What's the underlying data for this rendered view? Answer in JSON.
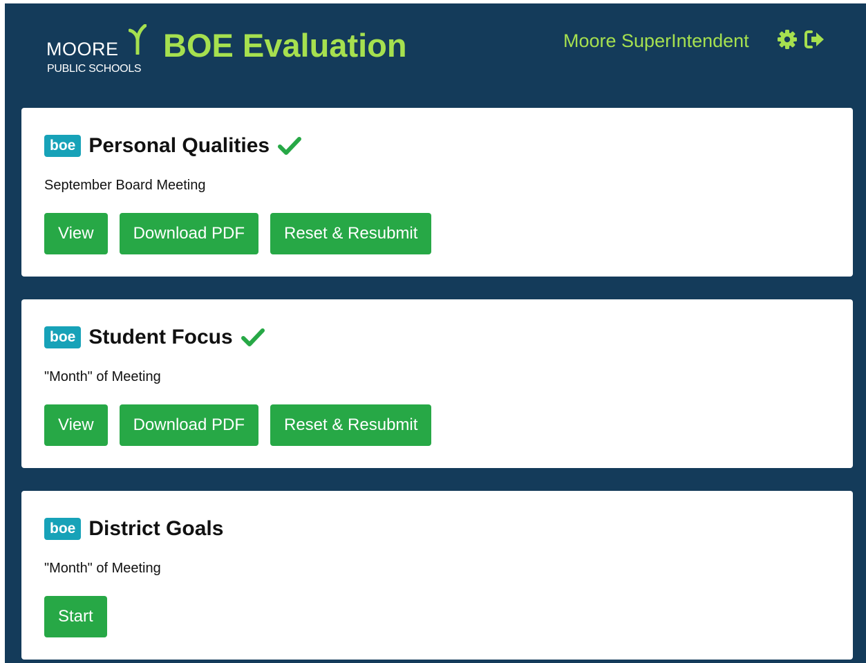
{
  "header": {
    "logo_name": "MOORE",
    "logo_subtitle": "PUBLIC SCHOOLS",
    "app_title": "BOE Evaluation",
    "user_name": "Moore SuperIntendent",
    "icons": [
      "gear-icon",
      "sign-out-icon"
    ]
  },
  "colors": {
    "background": "#143b5a",
    "accent": "#a6e04f",
    "badge": "#17a2b8",
    "button": "#27a846",
    "check": "#27a846"
  },
  "evaluations": [
    {
      "badge": "boe",
      "title": "Personal Qualities",
      "completed": true,
      "subtitle": "September Board Meeting",
      "buttons": [
        "View",
        "Download PDF",
        "Reset & Resubmit"
      ]
    },
    {
      "badge": "boe",
      "title": "Student Focus",
      "completed": true,
      "subtitle": "\"Month\" of Meeting",
      "buttons": [
        "View",
        "Download PDF",
        "Reset & Resubmit"
      ]
    },
    {
      "badge": "boe",
      "title": "District Goals",
      "completed": false,
      "subtitle": "\"Month\" of Meeting",
      "buttons": [
        "Start"
      ]
    }
  ]
}
